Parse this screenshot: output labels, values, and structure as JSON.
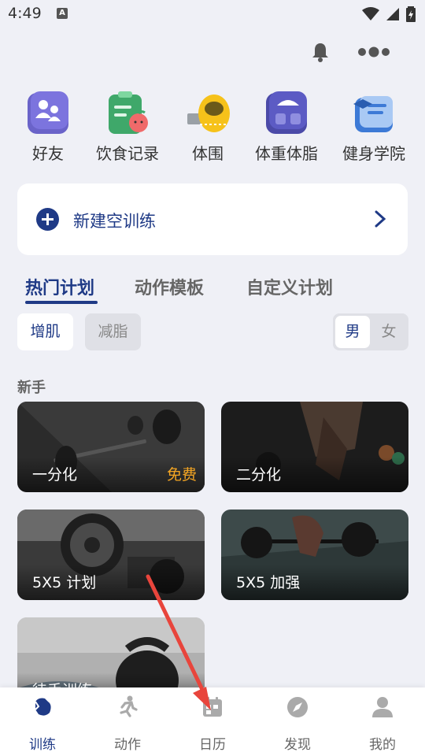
{
  "status_bar": {
    "time": "4:49",
    "notif_glyph": "A"
  },
  "header": {
    "icons": [
      "bell-icon",
      "more-icon"
    ]
  },
  "quick_actions": [
    {
      "label": "好友",
      "icon": "friends-icon"
    },
    {
      "label": "饮食记录",
      "icon": "diet-record-icon"
    },
    {
      "label": "体围",
      "icon": "measuring-tape-icon"
    },
    {
      "label": "体重体脂",
      "icon": "scale-icon"
    },
    {
      "label": "健身学院",
      "icon": "academy-icon"
    }
  ],
  "new_workout": {
    "title": "新建空训练"
  },
  "tabs": [
    {
      "label": "热门计划",
      "active": true
    },
    {
      "label": "动作模板",
      "active": false
    },
    {
      "label": "自定义计划",
      "active": false
    }
  ],
  "filters": {
    "goal": [
      {
        "label": "增肌",
        "active": true
      },
      {
        "label": "减脂",
        "active": false
      }
    ],
    "gender": [
      {
        "label": "男",
        "active": true
      },
      {
        "label": "女",
        "active": false
      }
    ]
  },
  "section": {
    "title": "新手"
  },
  "plans": [
    {
      "name": "一分化",
      "badge": "免费"
    },
    {
      "name": "二分化",
      "badge": ""
    },
    {
      "name": "5X5 计划",
      "badge": ""
    },
    {
      "name": "5X5 加强",
      "badge": ""
    },
    {
      "name": "徒手训练",
      "badge": ""
    }
  ],
  "bottom_nav": [
    {
      "label": "训练",
      "icon": "training-icon",
      "active": true
    },
    {
      "label": "动作",
      "icon": "exercise-run-icon",
      "active": false
    },
    {
      "label": "日历",
      "icon": "calendar-icon",
      "active": false
    },
    {
      "label": "发现",
      "icon": "compass-icon",
      "active": false
    },
    {
      "label": "我的",
      "icon": "profile-icon",
      "active": false
    }
  ],
  "colors": {
    "primary": "#1f3a86",
    "background": "#eff0f6",
    "free_badge": "#f5a623",
    "annotation_arrow": "#e8453c"
  }
}
